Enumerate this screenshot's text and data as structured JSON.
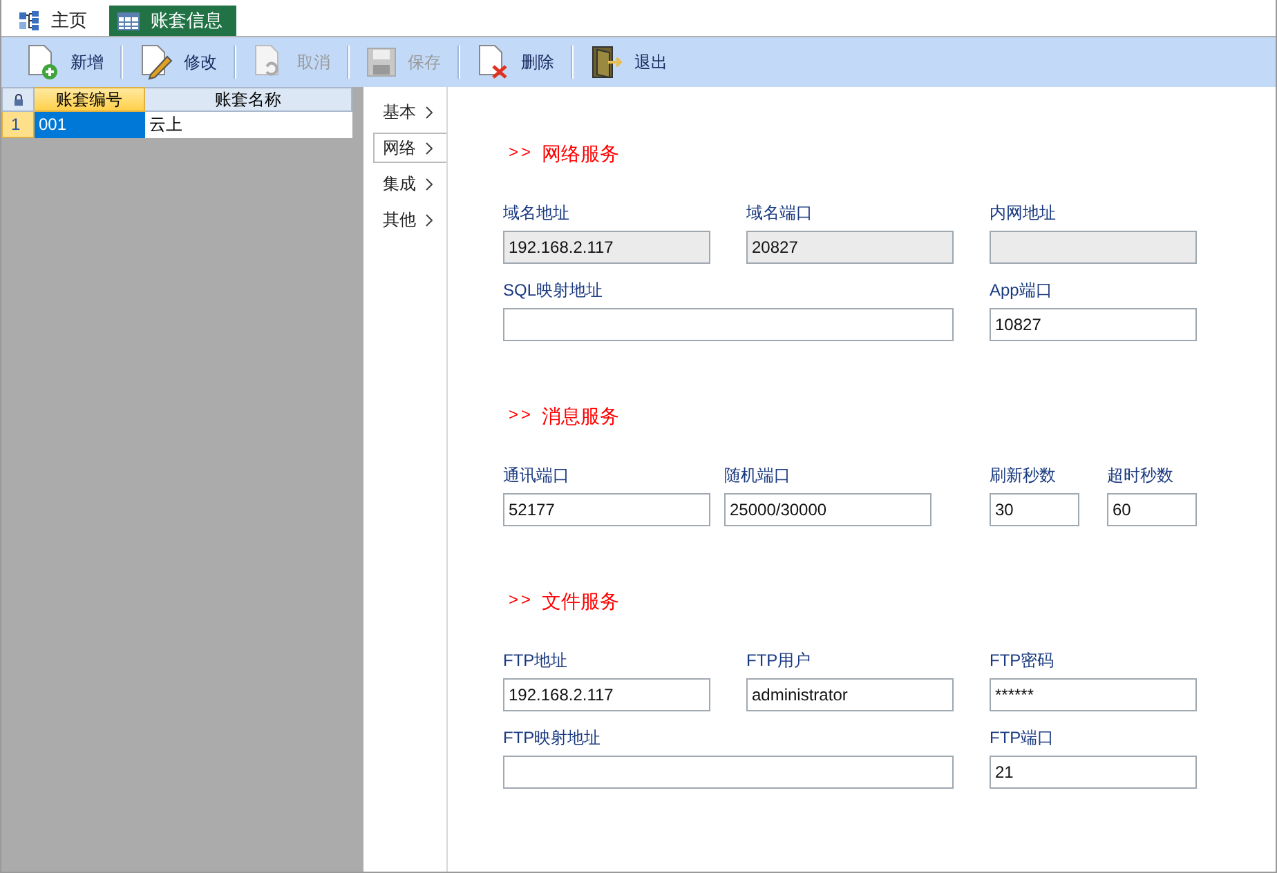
{
  "tabs": [
    {
      "label": "主页",
      "kind": "tree",
      "selected": false
    },
    {
      "label": "账套信息",
      "kind": "table",
      "selected": true
    }
  ],
  "toolbar": [
    {
      "label": "新增",
      "kind": "new",
      "disabled": false
    },
    {
      "label": "修改",
      "kind": "edit",
      "disabled": false
    },
    {
      "label": "取消",
      "kind": "undo",
      "disabled": true
    },
    {
      "label": "保存",
      "kind": "save",
      "disabled": true
    },
    {
      "label": "删除",
      "kind": "delete",
      "disabled": false
    },
    {
      "label": "退出",
      "kind": "exit",
      "disabled": false
    }
  ],
  "grid": {
    "columns": [
      {
        "label": "账套编号",
        "selected": true
      },
      {
        "label": "账套名称",
        "selected": false
      }
    ],
    "rows": [
      {
        "number": "1",
        "cells": [
          "001",
          "云上"
        ],
        "selected": true
      }
    ]
  },
  "nav": [
    {
      "label": "基本",
      "selected": false
    },
    {
      "label": "网络",
      "selected": true
    },
    {
      "label": "集成",
      "selected": false
    },
    {
      "label": "其他",
      "selected": false
    }
  ],
  "sections": [
    {
      "marker": ">>",
      "title": "网络服务",
      "rows": [
        {
          "kind": "triple",
          "fields": [
            {
              "label": "域名地址",
              "value": "192.168.2.117",
              "disabled": true
            },
            {
              "label": "域名端口",
              "value": "20827",
              "disabled": true
            },
            {
              "label": "内网地址",
              "disabled": true
            }
          ]
        },
        {
          "kind": "wide",
          "fields": [
            {
              "label": "SQL映射地址",
              "disabled": false
            },
            {
              "label": "App端口",
              "value": "10827",
              "disabled": false
            }
          ]
        }
      ]
    },
    {
      "marker": ">>",
      "title": "消息服务",
      "rows": [
        {
          "kind": "quad",
          "fields": [
            {
              "label": "通讯端口",
              "value": "52177",
              "disabled": false
            },
            {
              "label": "随机端口",
              "value": "25000/30000",
              "disabled": false
            },
            {
              "label": "刷新秒数",
              "value": "30",
              "disabled": false
            },
            {
              "label": "超时秒数",
              "value": "60",
              "disabled": false
            }
          ]
        }
      ]
    },
    {
      "marker": ">>",
      "title": "文件服务",
      "rows": [
        {
          "kind": "triple",
          "fields": [
            {
              "label": "FTP地址",
              "value": "192.168.2.117",
              "disabled": false
            },
            {
              "label": "FTP用户",
              "value": "administrator",
              "disabled": false
            },
            {
              "label": "FTP密码",
              "value": "******",
              "disabled": false
            }
          ]
        },
        {
          "kind": "wide",
          "fields": [
            {
              "label": "FTP映射地址",
              "disabled": false
            },
            {
              "label": "FTP端口",
              "value": "21",
              "disabled": false
            }
          ]
        }
      ]
    }
  ]
}
